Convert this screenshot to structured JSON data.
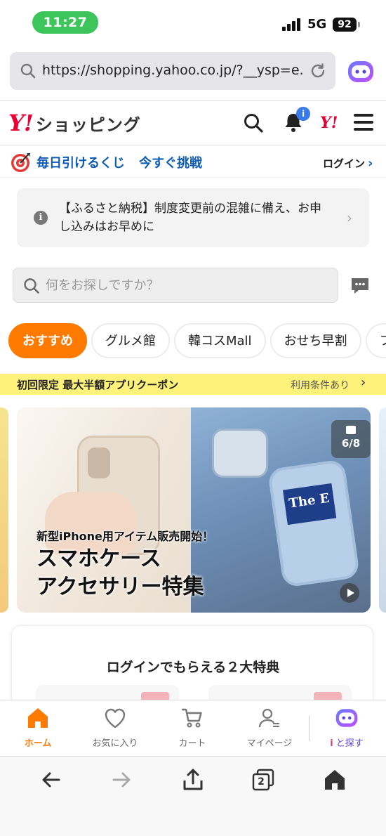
{
  "status_bar": {
    "time": "11:27",
    "network": "5G",
    "battery": "92"
  },
  "browser": {
    "url": "https://shopping.yahoo.co.jp/?__ysp=e...",
    "tab_count": "2"
  },
  "header": {
    "logo_mark": "Y!",
    "logo_text": "ショッピング",
    "notification_badge": "i",
    "yahoo_mark": "Y!"
  },
  "lottery": {
    "label": "毎日引けるくじ",
    "challenge": "今すぐ挑戦",
    "login": "ログイン"
  },
  "notice": {
    "text": "【ふるさと納税】制度変更前の混雑に備え、お申し込みはお早めに",
    "info_glyph": "i"
  },
  "search": {
    "placeholder": "何をお探しですか？"
  },
  "categories": [
    {
      "label": "おすすめ"
    },
    {
      "label": "グルメ館"
    },
    {
      "label": "韓コスMall"
    },
    {
      "label": "おせち早割"
    },
    {
      "label": "ファ"
    }
  ],
  "coupon": {
    "text": "初回限定 最大半額アプリクーポン",
    "conditions": "利用条件あり"
  },
  "banner": {
    "subtitle": "新型iPhone用アイテム販売開始！",
    "title_line1": "スマホケース",
    "title_line2": "アクセサリー特集",
    "counter": "6/8",
    "case_card_text": "The E"
  },
  "benefits": {
    "title": "ログインでもらえる２大特典"
  },
  "tabbar": {
    "home": "ホーム",
    "favorites": "お気に入り",
    "cart": "カート",
    "mypage": "マイページ",
    "ai_prefix": "i",
    "ai_search": "と探す"
  },
  "colors": {
    "brand_red": "#e60033",
    "accent_orange": "#ff7a00",
    "link_blue": "#0d5bb5",
    "coupon_yellow": "#fff27a",
    "status_green": "#3bc55b"
  }
}
